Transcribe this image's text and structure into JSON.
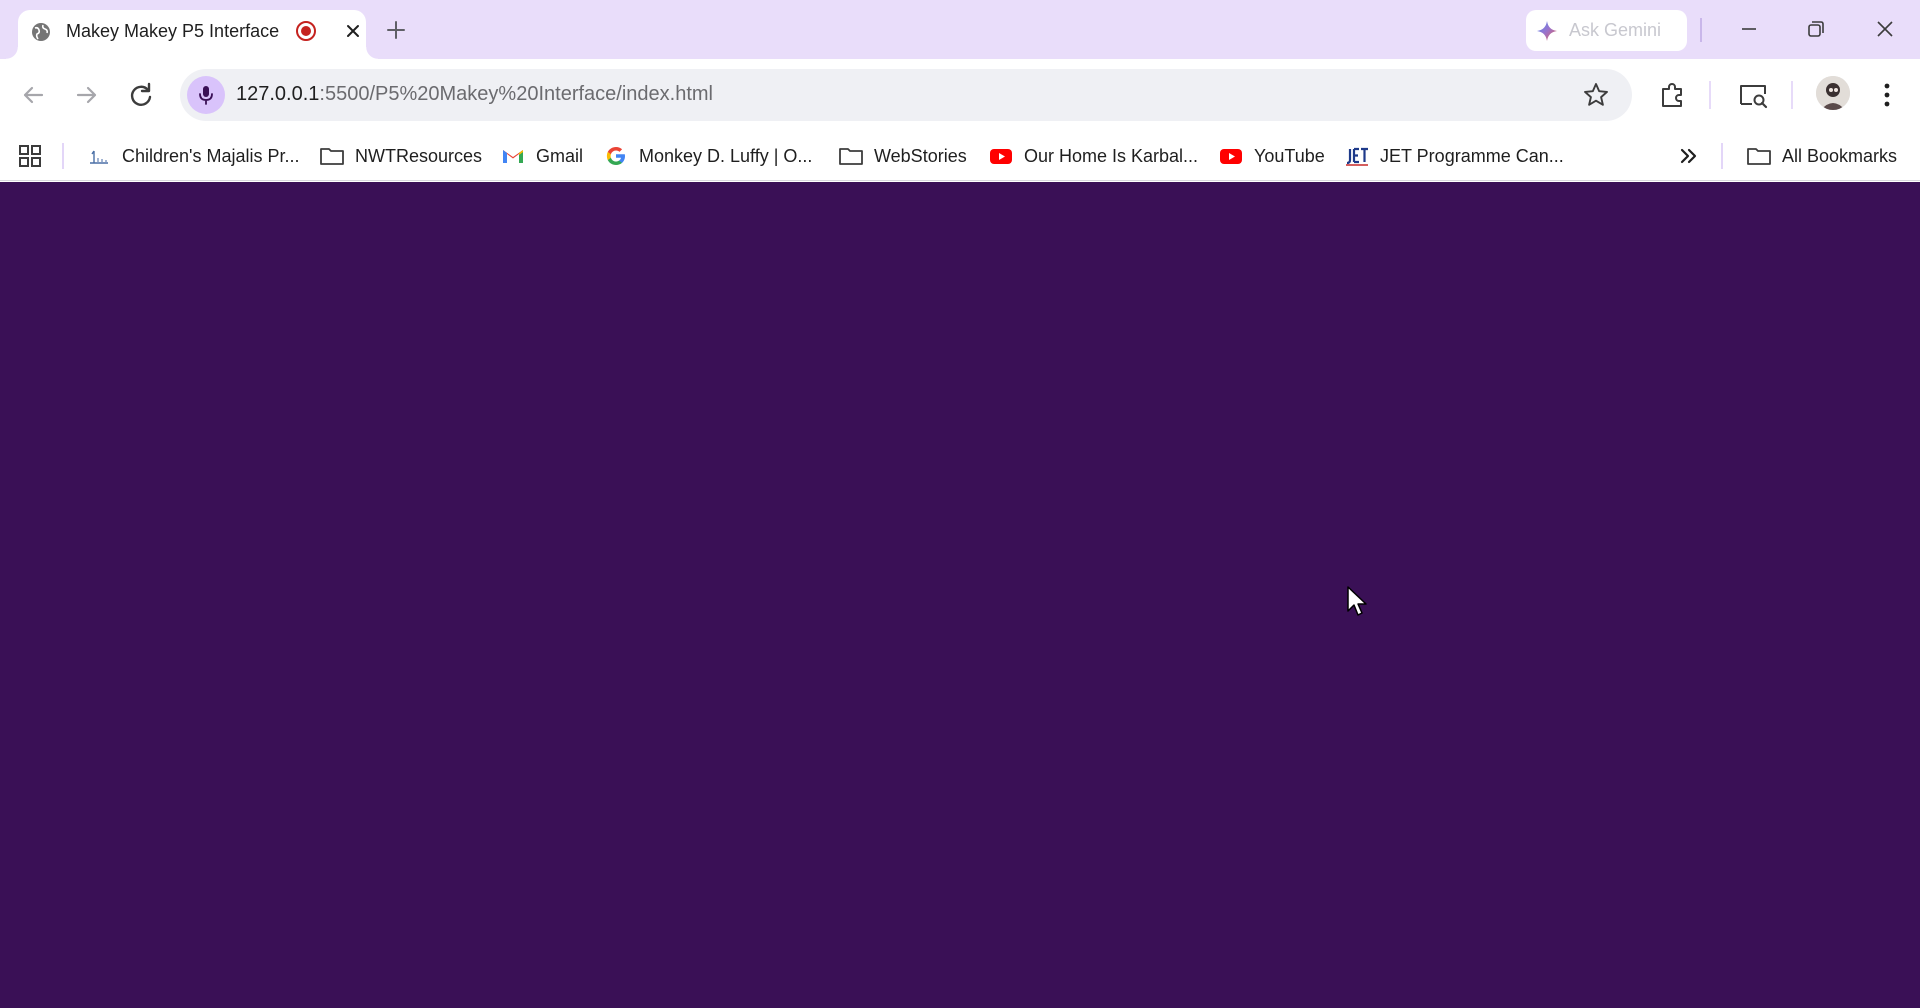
{
  "browser": {
    "tab": {
      "title": "Makey Makey P5 Interface",
      "favicon": "globe-icon",
      "recording_indicator": "record-icon",
      "close": "close-icon"
    },
    "new_tab": "plus-icon",
    "gemini": {
      "label": "Ask Gemini",
      "icon": "gemini-sparkle-icon"
    },
    "window_controls": [
      "minimize-icon",
      "restore-icon",
      "close-icon"
    ],
    "address_bar": {
      "host": "127.0.0.1",
      "path": ":5500/P5%20Makey%20Interface/index.html",
      "mic_icon": "microphone-icon",
      "bookmark_icon": "star-icon"
    },
    "toolbar_icons": [
      "extensions-icon",
      "search-tab-icon",
      "profile-avatar",
      "more-vert-icon"
    ],
    "bookmarks": [
      {
        "label": "Children's Majalis Pr...",
        "icon": "site-icon"
      },
      {
        "label": "NWTResources",
        "icon": "folder-icon"
      },
      {
        "label": "Gmail",
        "icon": "gmail-icon"
      },
      {
        "label": "Monkey D. Luffy | O...",
        "icon": "google-icon"
      },
      {
        "label": "WebStories",
        "icon": "folder-icon"
      },
      {
        "label": "Our Home Is Karbal...",
        "icon": "youtube-icon"
      },
      {
        "label": "YouTube",
        "icon": "youtube-icon"
      },
      {
        "label": "JET Programme Can...",
        "icon": "jet-icon"
      }
    ],
    "all_bookmarks": "All Bookmarks"
  },
  "page": {
    "background": "#3a1056"
  },
  "colors": {
    "tabstrip": "#e9ddfa",
    "accent": "#d9c3fb",
    "record": "#c5221f",
    "youtube": "#ff0000"
  }
}
